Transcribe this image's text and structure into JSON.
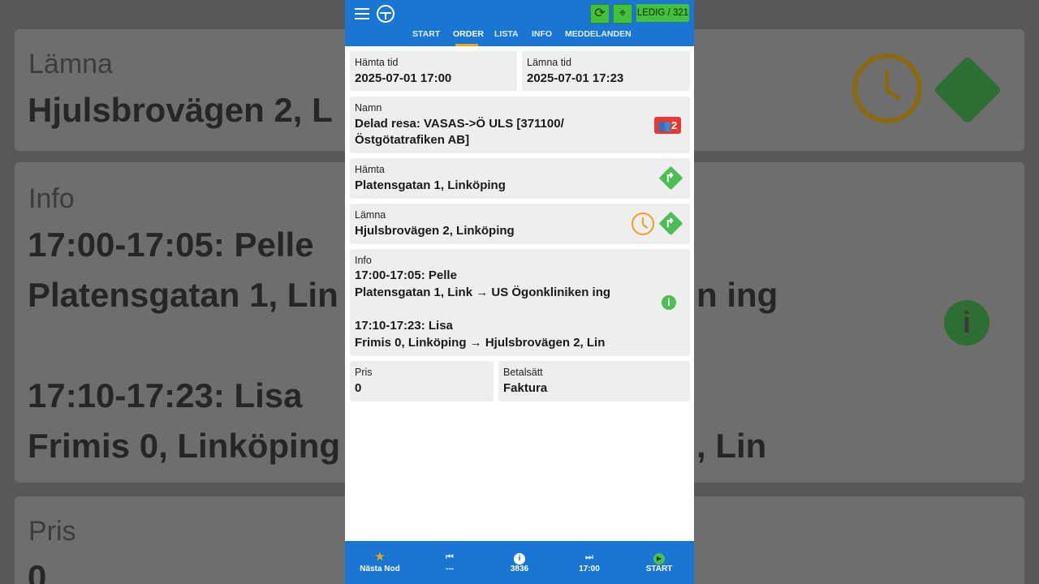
{
  "background": {
    "lamna_label": "Lämna",
    "lamna_value": "Hjulsbrovägen 2, L",
    "info_label": "Info",
    "info_line1": "17:00-17:05: Pelle",
    "info_line2a": "Platensgatan 1, Lin",
    "info_line2b": "n ing",
    "info_line3": "17:10-17:23: Lisa",
    "info_line4a": "Frimis 0, Linköping",
    "info_line4b": ", Lin",
    "pris_label": "Pris",
    "pris_value": "0"
  },
  "header": {
    "status": "LEDIG / 321",
    "tabs": [
      "START",
      "ORDER",
      "LISTA",
      "INFO",
      "MEDDELANDEN"
    ],
    "active_tab": "ORDER"
  },
  "order": {
    "hamta_tid_label": "Hämta tid",
    "hamta_tid_value": "2025-07-01 17:00",
    "lamna_tid_label": "Lämna tid",
    "lamna_tid_value": "2025-07-01 17:23",
    "namn_label": "Namn",
    "namn_line1": "Delad resa: VASAS->Ö ULS [371100/",
    "namn_line2": "Östgötatrafiken AB]",
    "passenger_count": "2",
    "hamta_label": "Hämta",
    "hamta_value": "Platensgatan 1, Linköping",
    "lamna_label": "Lämna",
    "lamna_value": "Hjulsbrovägen 2, Linköping",
    "info_label": "Info",
    "info_lines": [
      "17:00-17:05: Pelle",
      "Platensgatan 1, Link → US Ögonkliniken ing",
      "17:10-17:23: Lisa",
      "Frimis 0, Linköping  → Hjulsbrovägen 2, Lin"
    ],
    "pris_label": "Pris",
    "pris_value": "0",
    "betalsatt_label": "Betalsätt",
    "betalsatt_value": "Faktura"
  },
  "bottom_nav": [
    {
      "label": "Nästa Nod",
      "icon": "star-icon",
      "color": "#f2a21b"
    },
    {
      "label": "---",
      "icon": "skip-previous-icon"
    },
    {
      "label": "3836",
      "icon": "info-icon"
    },
    {
      "label": "17:00",
      "icon": "skip-next-icon"
    },
    {
      "label": "START",
      "icon": "play-circle-icon",
      "color": "#4cbe55"
    }
  ],
  "colors": {
    "primary": "#1976d2",
    "accent": "#f2a21b",
    "status_green": "#43c13a",
    "badge_red": "#e53935"
  }
}
